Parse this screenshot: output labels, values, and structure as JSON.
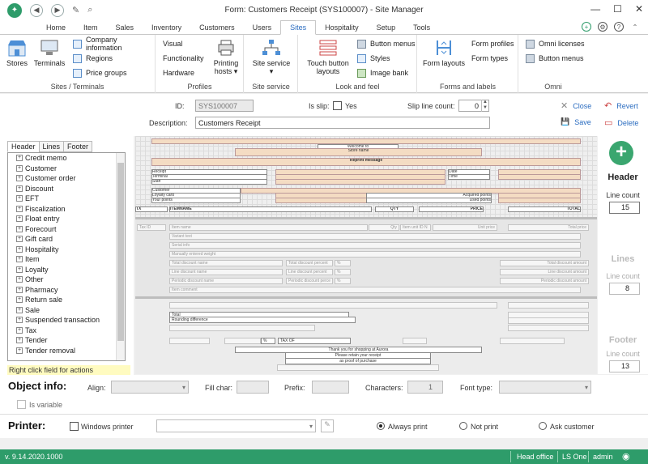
{
  "window": {
    "title": "Form: Customers Receipt (SYS100007) - Site Manager",
    "logo_glyph": "✦",
    "minimize_glyph": "—",
    "maximize_glyph": "☐",
    "close_glyph": "✕"
  },
  "quick_access": {
    "back_glyph": "◀",
    "forward_glyph": "▶",
    "new_glyph": "✎",
    "search_glyph": "⌕"
  },
  "tabs": [
    "Home",
    "Item",
    "Sales",
    "Inventory",
    "Customers",
    "Users",
    "Sites",
    "Hospitality",
    "Setup",
    "Tools"
  ],
  "active_tab": "Sites",
  "tab_right_glyphs": {
    "add": "+",
    "settings": "⚙",
    "help": "?",
    "up": "⌃"
  },
  "ribbon": {
    "sites_terminals": {
      "label": "Sites / Terminals",
      "stores": "Stores",
      "terminals": "Terminals",
      "company_information": "Company information",
      "regions": "Regions",
      "price_groups": "Price groups"
    },
    "profiles": {
      "label": "Profiles",
      "visual": "Visual",
      "functionality": "Functionality",
      "hardware": "Hardware",
      "printing_hosts": "Printing hosts ▾"
    },
    "site_service": {
      "label": "Site service",
      "site_service_btn": "Site service ▾"
    },
    "look_and_feel": {
      "label": "Look and feel",
      "touch_button_layouts": "Touch button layouts",
      "button_menus": "Button menus",
      "styles": "Styles",
      "image_bank": "Image bank"
    },
    "forms_and_labels": {
      "label": "Forms and labels",
      "form_layouts": "Form layouts",
      "form_profiles": "Form profiles",
      "form_types": "Form types"
    },
    "omni": {
      "label": "Omni",
      "omni_licenses": "Omni licenses",
      "button_menus": "Button menus"
    }
  },
  "form": {
    "id_label": "ID:",
    "id_value": "SYS100007",
    "is_slip_label": "Is slip:",
    "yes_label": "Yes",
    "slip_line_count_label": "Slip line count:",
    "slip_line_count_value": "0",
    "description_label": "Description:",
    "description_value": "Customers Receipt",
    "close": "Close",
    "save": "Save",
    "revert": "Revert",
    "delete": "Delete",
    "close_glyph": "✕",
    "save_glyph": "💾",
    "revert_glyph": "↶",
    "delete_glyph": "▭"
  },
  "left_panel": {
    "tabs": [
      "Header",
      "Lines",
      "Footer"
    ],
    "active_tab": "Header",
    "tree_items": [
      "Credit memo",
      "Customer",
      "Customer order",
      "Discount",
      "EFT",
      "Fiscalization",
      "Float entry",
      "Forecourt",
      "Gift card",
      "Hospitality",
      "Item",
      "Loyalty",
      "Other",
      "Pharmacy",
      "Return sale",
      "Sale",
      "Suspended transaction",
      "Tax",
      "Tender",
      "Tender removal"
    ],
    "expander_glyph": "+",
    "hint": "Right click field for actions"
  },
  "canvas": {
    "header": {
      "welcome": "Welcome to",
      "store_name": "Store name",
      "reprint": "Reprint message",
      "receipt": "Receipt",
      "terminal": "Terminal",
      "staff": "Staff",
      "date": "Date",
      "time": "Time",
      "customer": "Customer",
      "loyalty_card": "Loyalty card",
      "your_points": "Your points",
      "acquired_points": "Acquired points",
      "used_points": "Used points",
      "tx": "TX",
      "itemname": "ITEMNAME",
      "qty": "QTY",
      "price": "PRICE",
      "total": "TOTAL"
    },
    "lines": {
      "tax_id": "Tax ID",
      "item_name": "Item name",
      "qty": "Qty",
      "item_unit_id": "Item unit ID N",
      "unit_price": "Unit price",
      "total_price": "Total price",
      "variant_text": "Variant text",
      "serial_info": "Serial info",
      "manually_entered_weight": "Manually entered weight",
      "total_discount_name": "Total discount name",
      "total_discount_percent": "Total discount percent",
      "total_discount_amount": "Total discount amount",
      "line_discount_name": "Line discount name",
      "line_discount_percent": "Line discount percent",
      "line_discount_amount": "Line discount amount",
      "periodic_discount_name": "Periodic discount name",
      "periodic_discount_percent": "Periodic discount perce",
      "periodic_discount_amount": "Periodic discount amount",
      "percent_sign": "%",
      "item_comment": "Item comment"
    },
    "footer": {
      "total": "Total",
      "rounding_difference": "Rounding difference",
      "tax_of": "TAX OF",
      "thanks": "Thank you for shopping at Aurora",
      "retain": "Please retain your receipt",
      "proof": "as proof of purchase"
    }
  },
  "sections": {
    "header": {
      "title": "Header",
      "line_count_label": "Line count",
      "line_count": "15",
      "add_glyph": "+"
    },
    "lines": {
      "title": "Lines",
      "line_count_label": "Line count",
      "line_count": "8"
    },
    "footer": {
      "title": "Footer",
      "line_count_label": "Line count",
      "line_count": "13"
    }
  },
  "object_info": {
    "title": "Object info:",
    "align_label": "Align:",
    "fill_char_label": "Fill char:",
    "prefix_label": "Prefix:",
    "characters_label": "Characters:",
    "characters_value": "1",
    "font_type_label": "Font type:",
    "is_variable_label": "Is variable"
  },
  "printer": {
    "title": "Printer:",
    "windows_printer_label": "Windows printer",
    "options": [
      "Always print",
      "Not print",
      "Ask customer"
    ],
    "selected": "Always print"
  },
  "status_bar": {
    "version": "v. 9.14.2020.1000",
    "head_office": "Head office",
    "ls_one": "LS One",
    "user": "admin",
    "menu_glyph": "◉"
  },
  "colors": {
    "accent_green": "#2e9c6a",
    "link_blue": "#2a6cc0",
    "field_tan": "#f4dcc3",
    "hint_yellow": "#fffbc0"
  }
}
